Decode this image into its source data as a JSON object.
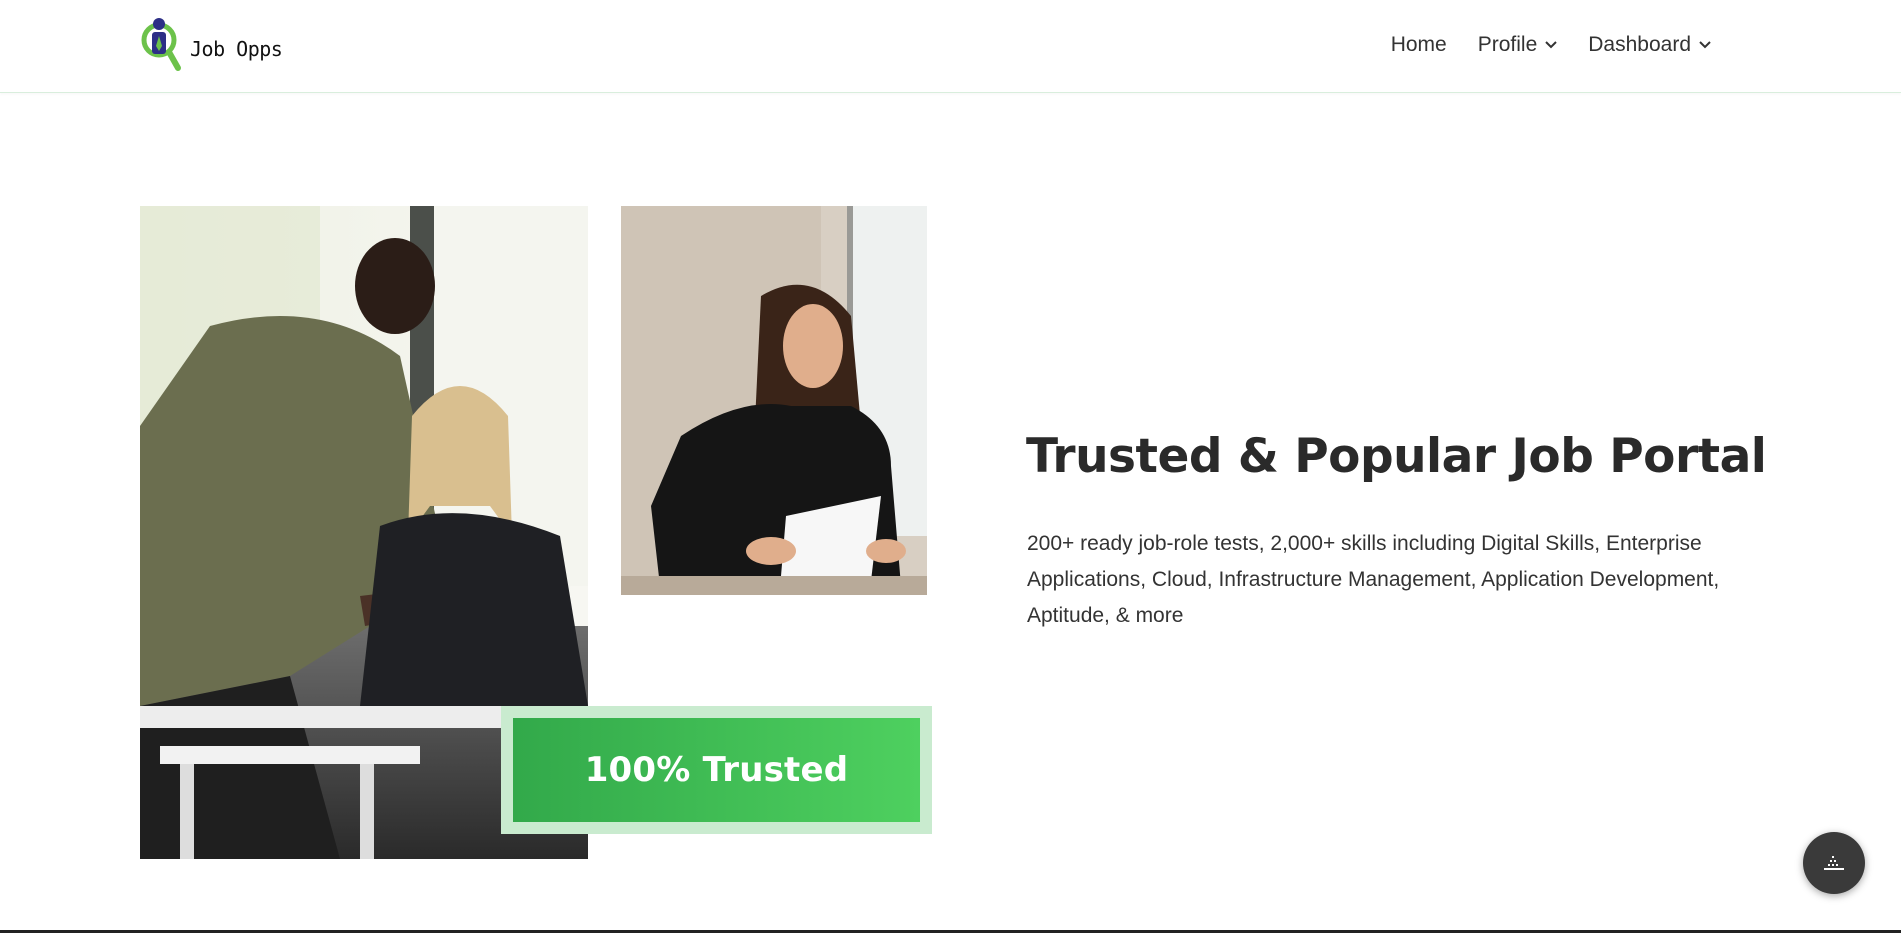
{
  "brand": {
    "name": "Job Opps"
  },
  "nav": {
    "items": [
      {
        "label": "Home",
        "has_dropdown": false
      },
      {
        "label": "Profile",
        "has_dropdown": true
      },
      {
        "label": "Dashboard",
        "has_dropdown": true
      }
    ]
  },
  "hero": {
    "badge": "100% Trusted",
    "headline": "Trusted & Popular Job Portal",
    "description": "200+ ready job-role tests, 2,000+ skills including Digital Skills, Enterprise Applications, Cloud, Infrastructure Management, Application Development, Aptitude, & more"
  },
  "colors": {
    "accent_green": "#4ed05f",
    "accent_green_dark": "#32a94a",
    "badge_frame": "#c9ebcf",
    "logo_blue": "#2d2f86",
    "fab_bg": "#3a3a3a"
  },
  "icons": [
    "job-opps-logo-icon",
    "chevron-down-icon",
    "widget-icon"
  ]
}
